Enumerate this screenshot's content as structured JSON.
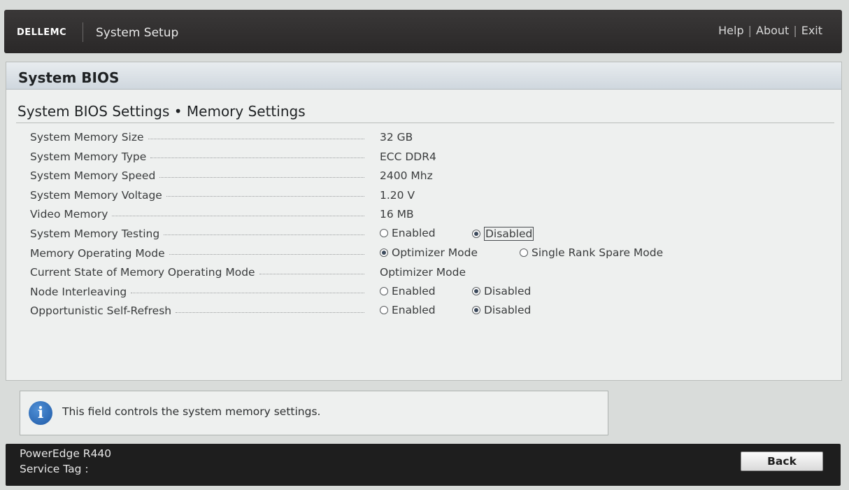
{
  "header": {
    "logo_text": "DELLEMC",
    "app_title": "System Setup",
    "links": {
      "help": "Help",
      "about": "About",
      "exit": "Exit",
      "separator": "|"
    }
  },
  "panel": {
    "title": "System BIOS",
    "breadcrumb": "System BIOS Settings • Memory Settings"
  },
  "settings": [
    {
      "label": "System Memory Size",
      "value": "32 GB"
    },
    {
      "label": "System Memory Type",
      "value": "ECC DDR4"
    },
    {
      "label": "System Memory Speed",
      "value": "2400 Mhz"
    },
    {
      "label": "System Memory Voltage",
      "value": "1.20 V"
    },
    {
      "label": "Video Memory",
      "value": "16 MB"
    },
    {
      "label": "System Memory Testing",
      "options": [
        {
          "label": "Enabled",
          "selected": false
        },
        {
          "label": "Disabled",
          "selected": true,
          "focused": true
        }
      ]
    },
    {
      "label": "Memory Operating Mode",
      "options": [
        {
          "label": "Optimizer Mode",
          "selected": true
        },
        {
          "label": "Single Rank Spare Mode",
          "selected": false
        }
      ]
    },
    {
      "label": "Current State of Memory Operating Mode",
      "value": "Optimizer Mode"
    },
    {
      "label": "Node Interleaving",
      "options": [
        {
          "label": "Enabled",
          "selected": false
        },
        {
          "label": "Disabled",
          "selected": true
        }
      ]
    },
    {
      "label": "Opportunistic Self-Refresh",
      "options": [
        {
          "label": "Enabled",
          "selected": false
        },
        {
          "label": "Disabled",
          "selected": true
        }
      ]
    }
  ],
  "info": {
    "icon": "info-icon",
    "icon_glyph": "i",
    "text": "This field controls the system memory settings."
  },
  "footer": {
    "model": "PowerEdge R440",
    "service_tag_label": "Service Tag :",
    "back_label": "Back"
  },
  "colors": {
    "header_bg": "#2e2c2c",
    "panel_bg": "#eef0ef",
    "footer_bg": "#1e1e1e",
    "info_icon": "#2a6bbd"
  }
}
